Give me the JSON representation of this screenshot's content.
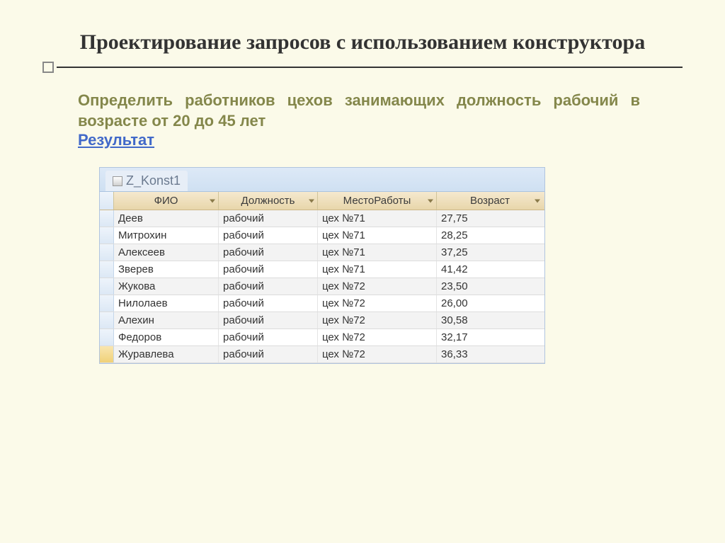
{
  "title": "Проектирование запросов с использованием конструктора",
  "description": "Определить работников цехов занимающих должность рабочий в возрасте от 20 до 45 лет",
  "result_link": "Результат",
  "tab_name": "Z_Konst1",
  "columns": [
    "ФИО",
    "Должность",
    "МестоРаботы",
    "Возраст"
  ],
  "rows": [
    {
      "fio": "Деев",
      "pos": "рабочий",
      "place": "цех №71",
      "age": "27,75",
      "active": false
    },
    {
      "fio": "Митрохин",
      "pos": "рабочий",
      "place": "цех №71",
      "age": "28,25",
      "active": false
    },
    {
      "fio": "Алексеев",
      "pos": "рабочий",
      "place": "цех №71",
      "age": "37,25",
      "active": false
    },
    {
      "fio": "Зверев",
      "pos": "рабочий",
      "place": "цех №71",
      "age": "41,42",
      "active": false
    },
    {
      "fio": "Жукова",
      "pos": "рабочий",
      "place": "цех №72",
      "age": "23,50",
      "active": false
    },
    {
      "fio": "Нилолаев",
      "pos": "рабочий",
      "place": "цех №72",
      "age": "26,00",
      "active": false
    },
    {
      "fio": "Алехин",
      "pos": "рабочий",
      "place": "цех №72",
      "age": "30,58",
      "active": false
    },
    {
      "fio": "Федоров",
      "pos": "рабочий",
      "place": "цех №72",
      "age": "32,17",
      "active": false
    },
    {
      "fio": "Журавлева",
      "pos": "рабочий",
      "place": "цех №72",
      "age": "36,33",
      "active": true
    }
  ]
}
